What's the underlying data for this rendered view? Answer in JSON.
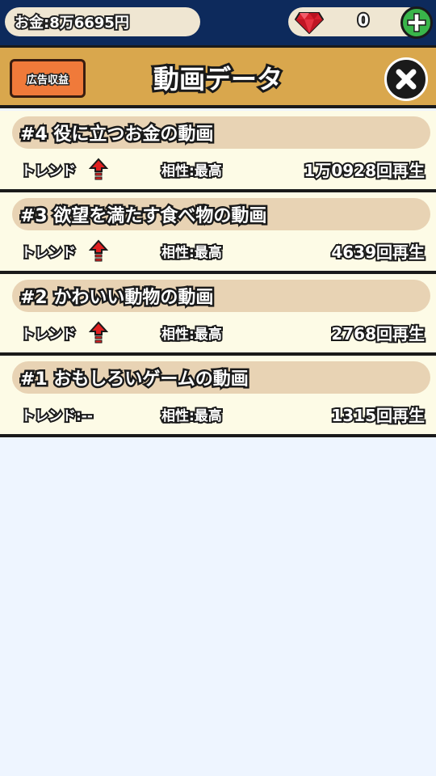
{
  "topbar": {
    "money_label": "お金:8万6695円",
    "gem_count": "0",
    "gem_icon": "red-gem-icon",
    "plus_icon": "plus-icon"
  },
  "header": {
    "ad_revenue_label": "広告収益",
    "title": "動画データ",
    "close_icon": "close-icon"
  },
  "videos": [
    {
      "title": "#4 役に立つお金の動画",
      "trend_label": "トレンド",
      "trend_up": true,
      "compat": "相性:最高",
      "views": "1万0928回再生"
    },
    {
      "title": "#3 欲望を満たす食べ物の動画",
      "trend_label": "トレンド",
      "trend_up": true,
      "compat": "相性:最高",
      "views": "4639回再生"
    },
    {
      "title": "#2 かわいい動物の動画",
      "trend_label": "トレンド",
      "trend_up": true,
      "compat": "相性:最高",
      "views": "2768回再生"
    },
    {
      "title": "#1 おもしろいゲームの動画",
      "trend_label": "トレンド:--",
      "trend_up": false,
      "compat": "相性:最高",
      "views": "1315回再生"
    }
  ],
  "colors": {
    "topbar": "#0d2a5c",
    "header": "#d9a74d",
    "card": "#fdfbe6",
    "title_bar": "#e8d3b4",
    "ad_button": "#f07a3a",
    "plus_button": "#39b54a",
    "background": "#eef5ff"
  }
}
